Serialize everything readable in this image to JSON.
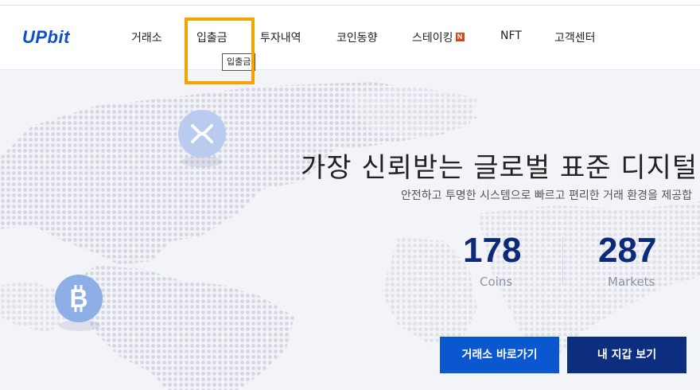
{
  "header": {
    "logo": "UPbit",
    "nav": [
      {
        "label": "거래소"
      },
      {
        "label": "입출금"
      },
      {
        "label": "투자내역"
      },
      {
        "label": "코인동향"
      },
      {
        "label": "스테이킹",
        "badge": "N"
      },
      {
        "label": "NFT"
      },
      {
        "label": "고객센터"
      }
    ],
    "tooltip": "입출금"
  },
  "hero": {
    "headline": "가장 신뢰받는 글로벌 표준 디지털 자",
    "subline": "안전하고 투명한 시스템으로 빠르고 편리한 거래 환경을 제공합",
    "stats": [
      {
        "value": "178",
        "label": "Coins"
      },
      {
        "value": "287",
        "label": "Markets"
      }
    ],
    "buttons": {
      "exchange": "거래소 바로가기",
      "wallet": "내 지갑 보기"
    }
  },
  "colors": {
    "brand": "#0b4fd1",
    "highlight": "#f5a300",
    "primary_button": "#0b57d0",
    "secondary_button": "#0d2d7e"
  },
  "icons": {
    "xrp": "xrp-coin-icon",
    "btc": "bitcoin-coin-icon"
  }
}
